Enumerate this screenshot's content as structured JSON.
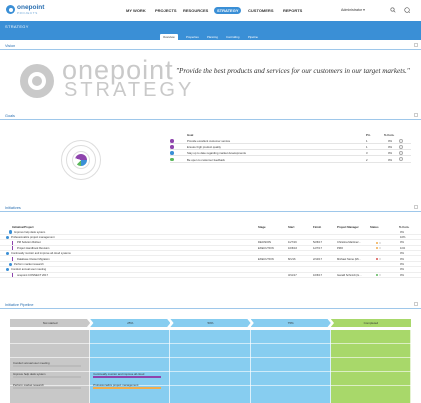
{
  "nav": {
    "brand": "onepoint",
    "brand_sub": "PROJECTS",
    "items": [
      "MY WORK",
      "PROJECTS",
      "RESOURCES",
      "STRATEGY",
      "CUSTOMERS",
      "REPORTS"
    ],
    "active": "STRATEGY",
    "admin": "Administrator ▾",
    "icons": [
      "search-icon",
      "help-icon"
    ]
  },
  "header": {
    "title": "STRATEGY",
    "tabs": [
      "Overview",
      "Properties",
      "Planning",
      "Controlling",
      "Pipeline"
    ],
    "active_tab": "Overview"
  },
  "vision": {
    "title": "Vision",
    "brand": "onepoint",
    "brand_sub": "STRATEGY",
    "quote": "\"Provide the best products and services for our customers in our target markets.\""
  },
  "goals": {
    "title": "Goals",
    "columns": [
      "Goal",
      "Pri.",
      "% Com."
    ],
    "rows": [
      {
        "label": "Provide excellent customer service",
        "priority": "1",
        "pct": "0%",
        "color": "#8e44ad"
      },
      {
        "label": "Ensure high product quality",
        "priority": "1",
        "pct": "0%",
        "color": "#8e44ad"
      },
      {
        "label": "Stay up to date regarding market developments",
        "priority": "3",
        "pct": "0%",
        "color": "#3a8fd6"
      },
      {
        "label": "Be open to customer feedback",
        "priority": "2",
        "pct": "0%",
        "color": "#5cb85c"
      }
    ]
  },
  "initiatives": {
    "title": "Initiatives",
    "columns": [
      "Initiative/Project",
      "Stage",
      "Start",
      "Finish",
      "Project Manager",
      "Status",
      "% Com."
    ],
    "rows": [
      {
        "name": "Improve help desk system",
        "stage": "",
        "start": "",
        "finish": "",
        "pm": "",
        "status": "",
        "pct": "0%",
        "indent": 1,
        "kind": "initiative"
      },
      {
        "name": "Professionalize project management",
        "stage": "",
        "start": "",
        "finish": "",
        "pm": "",
        "status": "",
        "pct": "10%",
        "indent": 0,
        "kind": "initiative"
      },
      {
        "name": "PM Solution Rollout",
        "stage": "DECISION",
        "start": "11/7/16",
        "finish": "5/26/17",
        "pm": "Christina Martinez...",
        "status": "#f0ad4e",
        "pct": "0%",
        "indent": 2,
        "kind": "project"
      },
      {
        "name": "Project Handbook Revision",
        "stage": "EXECUTION",
        "start": "10/6/16",
        "finish": "1/27/17",
        "pm": "PMO",
        "status": "#f0ad4e",
        "pct": "11%",
        "indent": 2,
        "kind": "project"
      },
      {
        "name": "Continually monitor and improve all cloud systems",
        "stage": "",
        "start": "",
        "finish": "",
        "pm": "",
        "status": "",
        "pct": "0%",
        "indent": 0,
        "kind": "initiative"
      },
      {
        "name": "Database Cluster Migration",
        "stage": "EXECUTION",
        "start": "8/1/16",
        "finish": "2/10/17",
        "pm": "Michael Stone (Mi...",
        "status": "#d9534f",
        "pct": "0%",
        "indent": 2,
        "kind": "project"
      },
      {
        "name": "Perform market research",
        "stage": "",
        "start": "",
        "finish": "",
        "pm": "",
        "status": "",
        "pct": "0%",
        "indent": 1,
        "kind": "initiative"
      },
      {
        "name": "Conduct annual user meeting",
        "stage": "",
        "start": "",
        "finish": "",
        "pm": "",
        "status": "",
        "pct": "0%",
        "indent": 0,
        "kind": "initiative"
      },
      {
        "name": "onepoint CONNECT 2017",
        "stage": "",
        "start": "3/11/17",
        "finish": "10/6/17",
        "pm": "Gerald Schmidt (G...",
        "status": "#5cb85c",
        "pct": "0%",
        "indent": 2,
        "kind": "project"
      }
    ]
  },
  "pipeline": {
    "title": "Initiative Pipeline",
    "stages": [
      {
        "label": "Not started",
        "color": "#c8c8c8"
      },
      {
        "label": "25%",
        "color": "#87cdf0"
      },
      {
        "label": "50%",
        "color": "#87cdf0"
      },
      {
        "label": "75%",
        "color": "#87cdf0"
      },
      {
        "label": "Completed",
        "color": "#a8d86a"
      }
    ],
    "cards": [
      {
        "label": "Conduct annual user meeting",
        "stage": 0,
        "row": 0,
        "bar": "#bbbbbb"
      },
      {
        "label": "Improve help desk system",
        "stage": 0,
        "row": 1,
        "bar": "#bbbbbb"
      },
      {
        "label": "Continually monitor and improve all cloud",
        "stage": 1,
        "row": 1,
        "bar": "#8e44ad"
      },
      {
        "label": "Perform market research",
        "stage": 0,
        "row": 2,
        "bar": "#bbbbbb"
      },
      {
        "label": "Professionalize project management",
        "stage": 1,
        "row": 2,
        "bar": "#f0ad4e"
      }
    ]
  }
}
